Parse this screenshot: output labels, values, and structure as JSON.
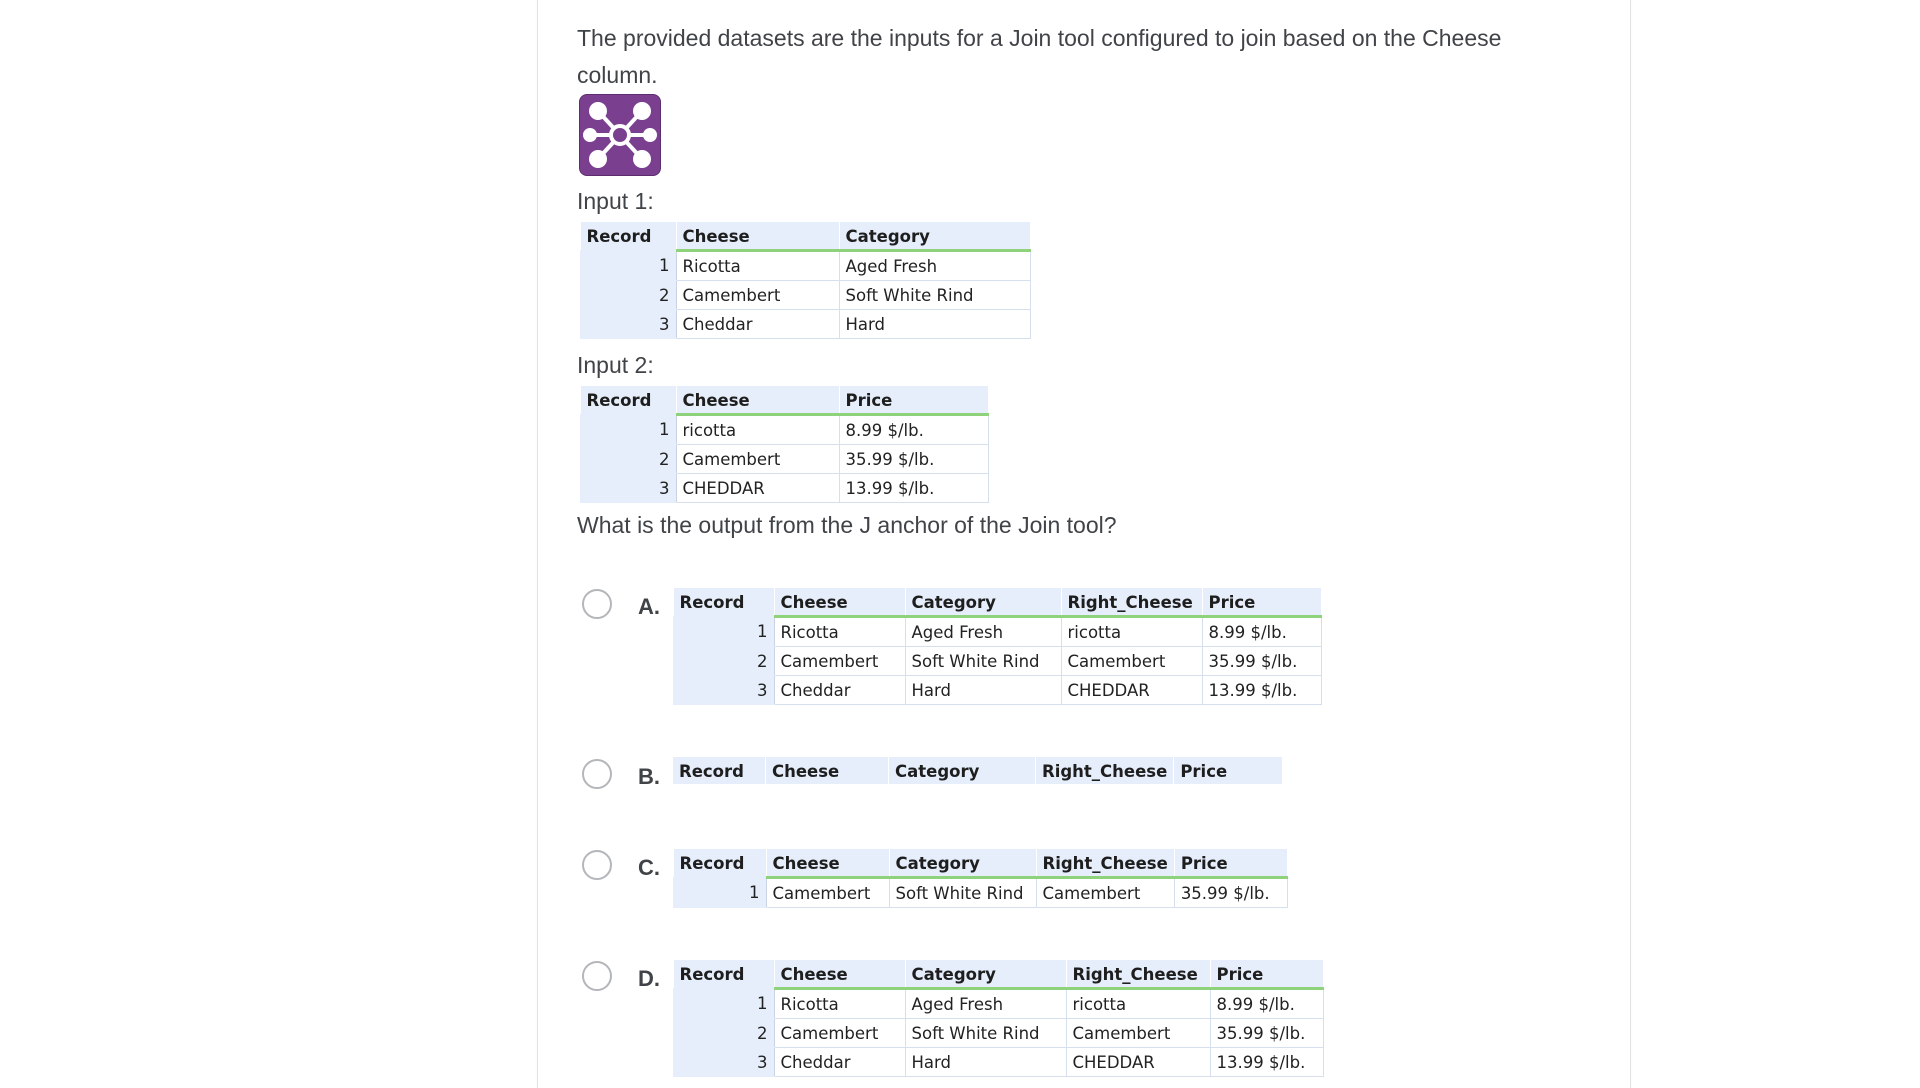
{
  "question": {
    "intro": "The provided datasets are the inputs for a Join tool configured to join based on the Cheese column.",
    "prompt": "What is the output from the J anchor of the Join tool?"
  },
  "icon": {
    "name": "join-tool-icon",
    "color": "#7b3f8f"
  },
  "input1": {
    "label": "Input 1:",
    "headers": [
      "Record",
      "Cheese",
      "Category"
    ],
    "rows": [
      [
        "1",
        "Ricotta",
        "Aged Fresh"
      ],
      [
        "2",
        "Camembert",
        "Soft White Rind"
      ],
      [
        "3",
        "Cheddar",
        "Hard"
      ]
    ]
  },
  "input2": {
    "label": "Input 2:",
    "headers": [
      "Record",
      "Cheese",
      "Price"
    ],
    "rows": [
      [
        "1",
        "ricotta",
        "8.99 $/lb."
      ],
      [
        "2",
        "Camembert",
        "35.99 $/lb."
      ],
      [
        "3",
        "CHEDDAR",
        "13.99 $/lb."
      ]
    ]
  },
  "options": [
    {
      "letter": "A.",
      "headers": [
        "Record",
        "Cheese",
        "Category",
        "Right_Cheese",
        "Price"
      ],
      "rows": [
        [
          "1",
          "Ricotta",
          "Aged Fresh",
          "ricotta",
          "8.99 $/lb."
        ],
        [
          "2",
          "Camembert",
          "Soft White Rind",
          "Camembert",
          "35.99 $/lb."
        ],
        [
          "3",
          "Cheddar",
          "Hard",
          "CHEDDAR",
          "13.99 $/lb."
        ]
      ]
    },
    {
      "letter": "B.",
      "headers": [
        "Record",
        "Cheese",
        "Category",
        "Right_Cheese",
        "Price"
      ],
      "rows": []
    },
    {
      "letter": "C.",
      "headers": [
        "Record",
        "Cheese",
        "Category",
        "Right_Cheese",
        "Price"
      ],
      "rows": [
        [
          "1",
          "Camembert",
          "Soft White Rind",
          "Camembert",
          "35.99 $/lb."
        ]
      ]
    },
    {
      "letter": "D.",
      "headers": [
        "Record",
        "Cheese",
        "Category",
        "Right_Cheese",
        "Price"
      ],
      "rows": [
        [
          "1",
          "Ricotta",
          "Aged Fresh",
          "ricotta",
          "8.99 $/lb."
        ],
        [
          "2",
          "Camembert",
          "Soft White Rind",
          "Camembert",
          "35.99 $/lb."
        ],
        [
          "3",
          "Cheddar",
          "Hard",
          "CHEDDAR",
          "13.99 $/lb."
        ]
      ]
    }
  ]
}
